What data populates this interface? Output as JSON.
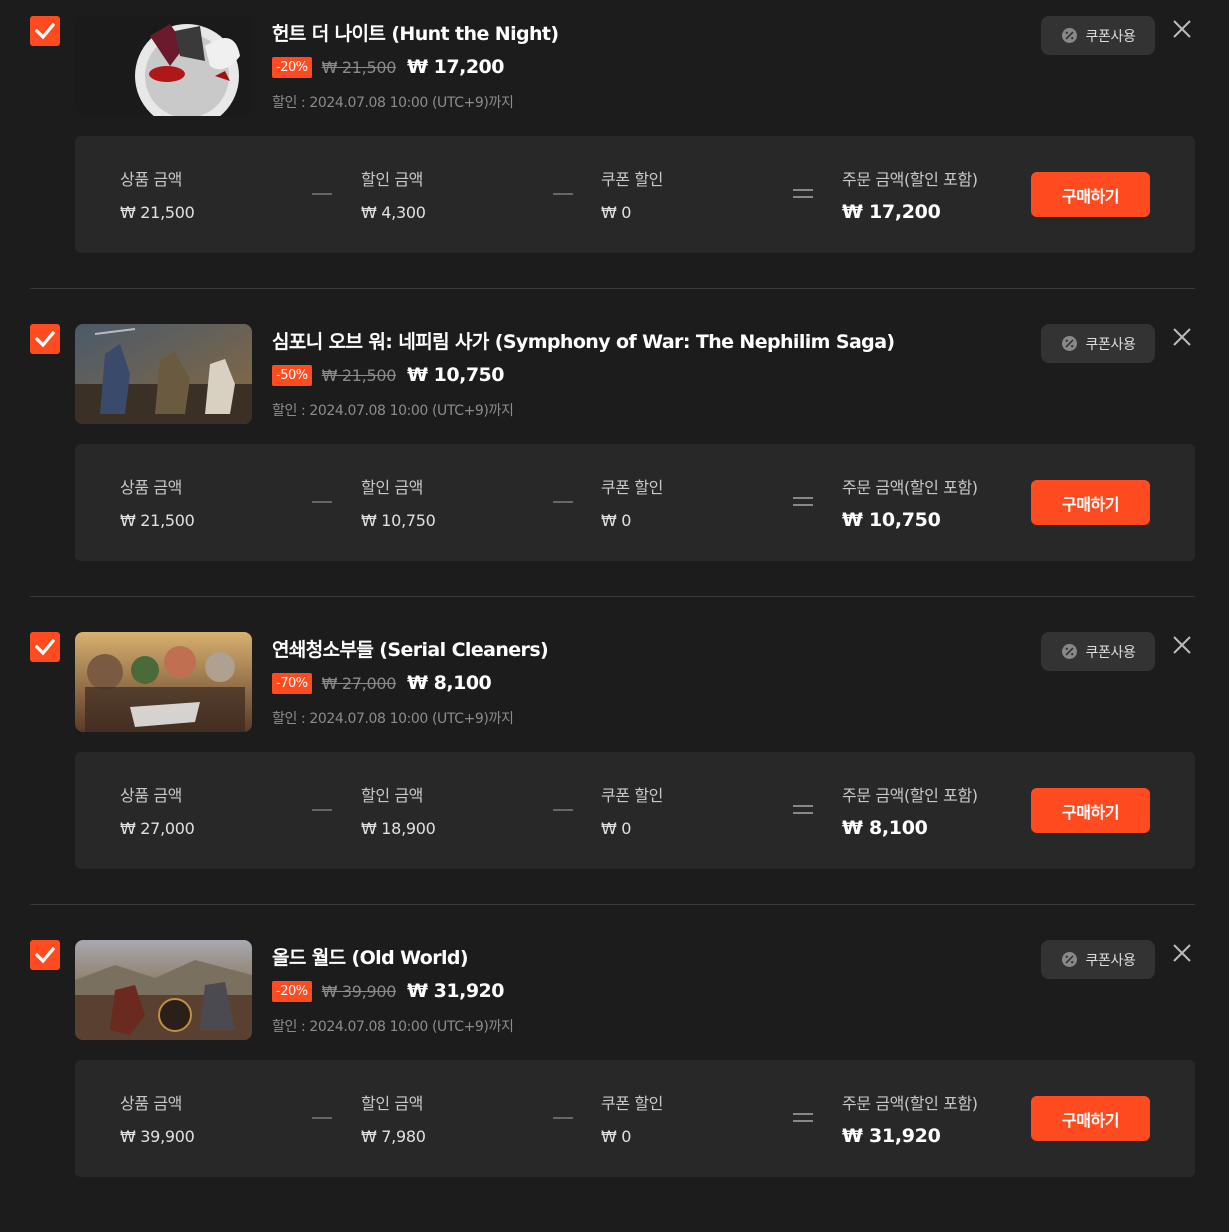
{
  "labels": {
    "coupon": "쿠폰사용",
    "product_amount": "상품 금액",
    "discount_amount": "할인 금액",
    "coupon_discount": "쿠폰 할인",
    "order_amount": "주문 금액(할인 포함)",
    "buy": "구매하기"
  },
  "items": [
    {
      "title": "헌트 더 나이트 (Hunt the Night)",
      "discount_badge": "-20%",
      "original_price": "₩ 21,500",
      "sale_price": "₩ 17,200",
      "sale_note": "할인 : 2024.07.08 10:00 (UTC+9)까지",
      "product_amount": "₩ 21,500",
      "discount_amount": "₩ 4,300",
      "coupon_discount": "₩ 0",
      "order_amount": "₩ 17,200",
      "checked": true
    },
    {
      "title": "심포니 오브 워: 네피림 사가 (Symphony of War: The Nephilim Saga)",
      "discount_badge": "-50%",
      "original_price": "₩ 21,500",
      "sale_price": "₩ 10,750",
      "sale_note": "할인 : 2024.07.08 10:00 (UTC+9)까지",
      "product_amount": "₩ 21,500",
      "discount_amount": "₩ 10,750",
      "coupon_discount": "₩ 0",
      "order_amount": "₩ 10,750",
      "checked": true
    },
    {
      "title": "연쇄청소부들 (Serial Cleaners)",
      "discount_badge": "-70%",
      "original_price": "₩ 27,000",
      "sale_price": "₩ 8,100",
      "sale_note": "할인 : 2024.07.08 10:00 (UTC+9)까지",
      "product_amount": "₩ 27,000",
      "discount_amount": "₩ 18,900",
      "coupon_discount": "₩ 0",
      "order_amount": "₩ 8,100",
      "checked": true
    },
    {
      "title": "올드 월드 (Old World)",
      "discount_badge": "-20%",
      "original_price": "₩ 39,900",
      "sale_price": "₩ 31,920",
      "sale_note": "할인 : 2024.07.08 10:00 (UTC+9)까지",
      "product_amount": "₩ 39,900",
      "discount_amount": "₩ 7,980",
      "coupon_discount": "₩ 0",
      "order_amount": "₩ 31,920",
      "checked": true
    }
  ],
  "colors": {
    "accent": "#ff4b1f",
    "background": "#1c1c1c",
    "panel": "#282828"
  }
}
